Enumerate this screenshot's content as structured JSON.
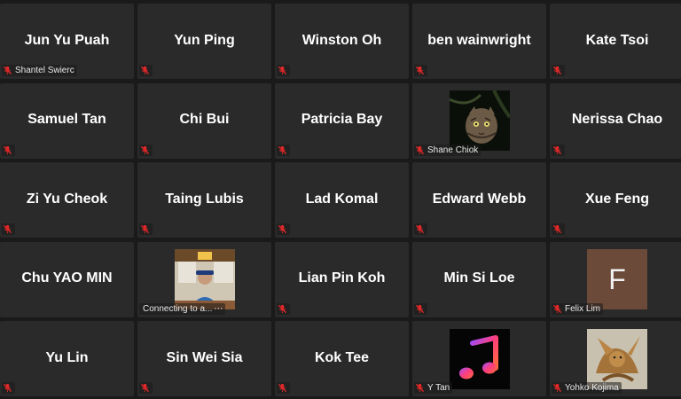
{
  "colors": {
    "background": "#1a1a1a",
    "tile": "#2a2a2a",
    "mute_icon": "#e02828",
    "name_text": "#ffffff"
  },
  "tiles": [
    {
      "id": "t1",
      "name": "Jun Yu Puah",
      "footer": "Shantel Swierc",
      "icon": "mic-muted-icon"
    },
    {
      "id": "t2",
      "name": "Yun Ping",
      "footer": "",
      "icon": "mic-muted-icon"
    },
    {
      "id": "t3",
      "name": "Winston Oh",
      "footer": "",
      "icon": "mic-muted-icon"
    },
    {
      "id": "t4",
      "name": "ben wainwright",
      "footer": "",
      "icon": "mic-muted-icon"
    },
    {
      "id": "t5",
      "name": "Kate Tsoi",
      "footer": "",
      "icon": "mic-muted-icon"
    },
    {
      "id": "t6",
      "name": "Samuel Tan",
      "footer": "",
      "icon": "mic-muted-icon"
    },
    {
      "id": "t7",
      "name": "Chi Bui",
      "footer": "",
      "icon": "mic-muted-icon"
    },
    {
      "id": "t8",
      "name": "Patricia Bay",
      "footer": "",
      "icon": "mic-muted-icon"
    },
    {
      "id": "t9",
      "name": "",
      "footer": "Shane Chiok",
      "icon": "mic-muted-icon",
      "picture": "cat-photo"
    },
    {
      "id": "t10",
      "name": "Nerissa Chao",
      "footer": "",
      "icon": "mic-muted-icon"
    },
    {
      "id": "t11",
      "name": "Zi Yu Cheok",
      "footer": "",
      "icon": "mic-muted-icon"
    },
    {
      "id": "t12",
      "name": "Taing Lubis",
      "footer": "",
      "icon": "mic-muted-icon"
    },
    {
      "id": "t13",
      "name": "Lad Komal",
      "footer": "",
      "icon": "mic-muted-icon"
    },
    {
      "id": "t14",
      "name": "Edward Webb",
      "footer": "",
      "icon": "mic-muted-icon"
    },
    {
      "id": "t15",
      "name": "Xue Feng",
      "footer": "",
      "icon": "mic-muted-icon"
    },
    {
      "id": "t16",
      "name": "Chu YAO MIN",
      "footer": "",
      "icon": "mic-muted-icon"
    },
    {
      "id": "t17",
      "name": "",
      "footer": "Connecting to a...",
      "icon": "none",
      "picture": "video-thumbnail"
    },
    {
      "id": "t18",
      "name": "Lian Pin Koh",
      "footer": "",
      "icon": "mic-muted-icon"
    },
    {
      "id": "t19",
      "name": "Min Si Loe",
      "footer": "",
      "icon": "mic-muted-icon"
    },
    {
      "id": "t20",
      "name": "",
      "footer": "Felix Lim",
      "icon": "mic-muted-icon",
      "picture": "letter-avatar",
      "avatar_letter": "F"
    },
    {
      "id": "t21",
      "name": "Yu Lin",
      "footer": "",
      "icon": "mic-muted-icon"
    },
    {
      "id": "t22",
      "name": "Sin Wei Sia",
      "footer": "",
      "icon": "mic-muted-icon"
    },
    {
      "id": "t23",
      "name": "Kok Tee",
      "footer": "",
      "icon": "mic-muted-icon"
    },
    {
      "id": "t24",
      "name": "",
      "footer": "Y Tan",
      "icon": "mic-muted-icon",
      "picture": "music-note-avatar"
    },
    {
      "id": "t25",
      "name": "",
      "footer": "Yohko Kojima",
      "icon": "mic-muted-icon",
      "picture": "dragon-photo"
    }
  ]
}
